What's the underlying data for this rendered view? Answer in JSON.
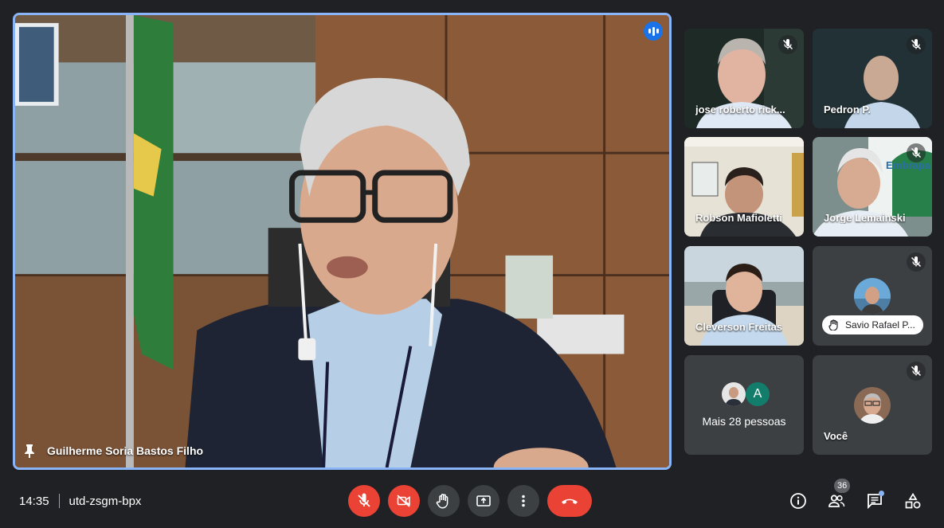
{
  "main_speaker": {
    "name": "Guilherme Soria Bastos Filho",
    "pin_icon": "pin-icon",
    "speaking_icon": "audio-level-icon"
  },
  "participants": [
    {
      "name": "jose roberto rick...",
      "muted": true
    },
    {
      "name": "Pedron P.",
      "muted": true
    },
    {
      "name": "Robson Mafioletti",
      "muted": false
    },
    {
      "name": "Jorge Lemainski",
      "muted": true
    },
    {
      "name": "Cleverson Freitas",
      "muted": false
    },
    {
      "name": "Savio Rafael P...",
      "muted": true,
      "hand_raised": true
    },
    {
      "name": "Você",
      "muted": true
    }
  ],
  "more_people": {
    "label": "Mais 28 pessoas",
    "letter_avatar": "A"
  },
  "bottom_bar": {
    "time": "14:35",
    "meeting_code": "utd-zsgm-bpx",
    "participant_count": "36",
    "controls": [
      "mic-off-icon",
      "camera-off-icon",
      "raise-hand-icon",
      "present-screen-icon",
      "more-options-icon",
      "hangup-icon"
    ],
    "right_icons": [
      "info-icon",
      "people-icon",
      "chat-icon",
      "activities-icon"
    ]
  },
  "colors": {
    "background": "#202124",
    "tile": "#3c4043",
    "accent_blue": "#8ab4f8",
    "red": "#ea4335",
    "avatar_teal": "#137d6b"
  }
}
